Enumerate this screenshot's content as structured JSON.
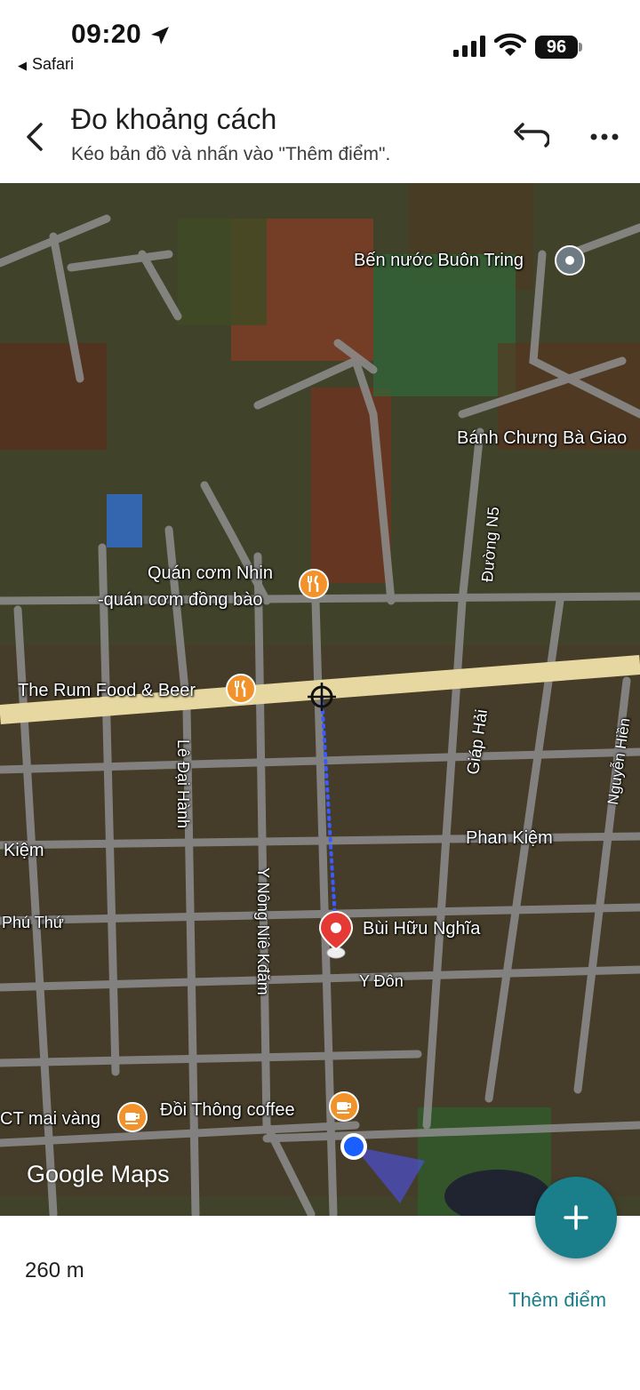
{
  "status_bar": {
    "time": "09:20",
    "back_app": "Safari",
    "battery": "96"
  },
  "header": {
    "title": "Đo khoảng cách",
    "subtitle": "Kéo bản đồ và nhấn vào \"Thêm điểm\"."
  },
  "map": {
    "places": {
      "ben_nuoc": "Bến nước Buôn Tring",
      "banh_chung": "Bánh Chưng Bà Giao",
      "quan_com_line1": "Quán cơm Nhin",
      "quan_com_line2": "-quán cơm đồng bào",
      "rum_food": "The Rum Food & Beer",
      "bui_huu_nghia": "Bùi Hữu Nghĩa",
      "doi_thong": "Đồi Thông coffee",
      "ct_mai_vang": "CT mai vàng"
    },
    "streets": {
      "duong_n5": "Đường N5",
      "giap_hai": "Giáp Hải",
      "nguyen_hien": "Nguyễn Hiền",
      "le_dai_hanh": "Lê Đại Hành",
      "phan_kiem": "Phan Kiệm",
      "kiem_left": "Kiệm",
      "phu_thu": "Phú Thứ",
      "y_nong": "Y Nông Niê Kđăm",
      "y_don": "Y Đôn"
    },
    "logo_google": "Google",
    "logo_maps": "Maps",
    "icons": {
      "restaurant": "fork-knife-icon",
      "cafe": "coffee-cup-icon",
      "landmark": "place-pin-icon",
      "pin": "red-location-pin-icon",
      "crosshair": "crosshair-icon",
      "my_location": "blue-dot-icon"
    }
  },
  "bottom": {
    "distance": "260 m",
    "add_point": "Thêm điểm"
  },
  "colors": {
    "accent": "#1a7f8a",
    "measure_line": "#3b5bff",
    "pin_red": "#e53935",
    "poi_orange": "#f2922b"
  }
}
